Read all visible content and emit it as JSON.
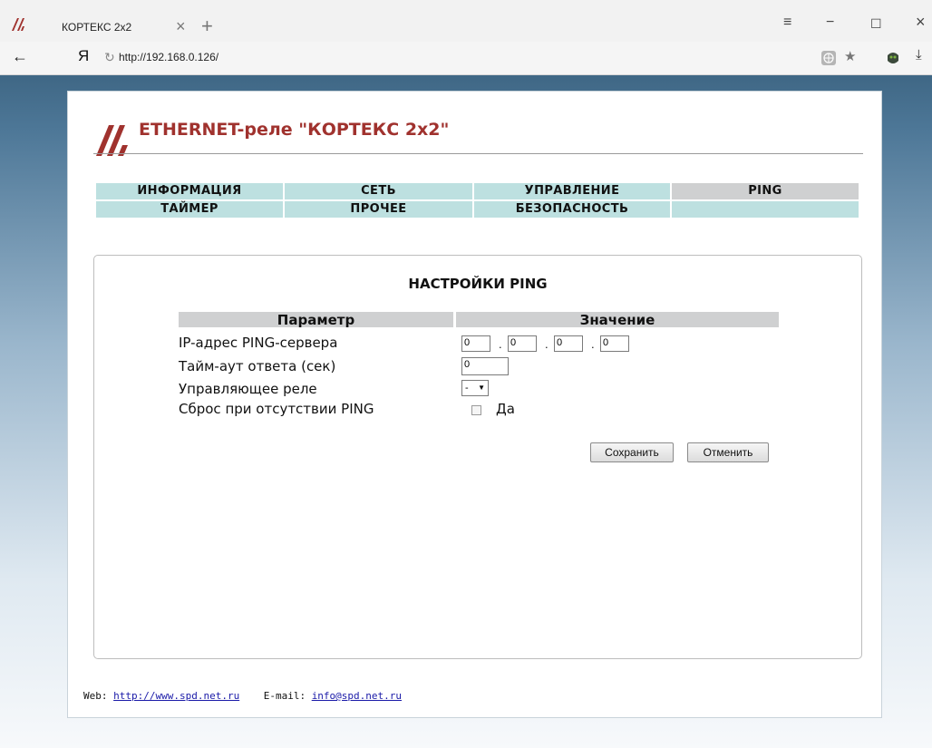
{
  "browser": {
    "tab_title": "КОРТЕКС 2x2",
    "tab_close": "×",
    "new_tab": "+",
    "menu_glyph": "≡",
    "minimize_glyph": "−",
    "maximize_glyph": "☐",
    "close_glyph": "×",
    "back_glyph": "←",
    "yandex_glyph": "Я",
    "reload_glyph": "↻",
    "url": "http://192.168.0.126/",
    "star_glyph": "★",
    "download_glyph": "⤓"
  },
  "header": {
    "title": "ETHERNET-реле \"КОРТЕКС 2x2\"",
    "brand_color": "#a0322e"
  },
  "nav": {
    "row1": [
      "ИНФОРМАЦИЯ",
      "СЕТЬ",
      "УПРАВЛЕНИЕ",
      "PING"
    ],
    "row2": [
      "ТАЙМЕР",
      "ПРОЧЕЕ",
      "БЕЗОПАСНОСТЬ",
      ""
    ],
    "active": "PING"
  },
  "panel": {
    "title": "НАСТРОЙКИ PING",
    "col_param": "Параметр",
    "col_value": "Значение",
    "rows": {
      "ip_label": "IP-адрес PING-сервера",
      "timeout_label": "Тайм-аут ответа (сек)",
      "relay_label": "Управляющее реле",
      "reset_label": "Сброс при отсутствии PING"
    },
    "ip": [
      "0",
      "0",
      "0",
      "0"
    ],
    "ip_sep": ".",
    "timeout": "0",
    "relay_selected": "-",
    "reset_checkbox_label": "Да",
    "reset_checked": false,
    "save_label": "Сохранить",
    "cancel_label": "Отменить"
  },
  "footer": {
    "web_label": "Web:",
    "web_link": "http://www.spd.net.ru",
    "email_label": "E-mail:",
    "email_link": "info@spd.net.ru"
  }
}
